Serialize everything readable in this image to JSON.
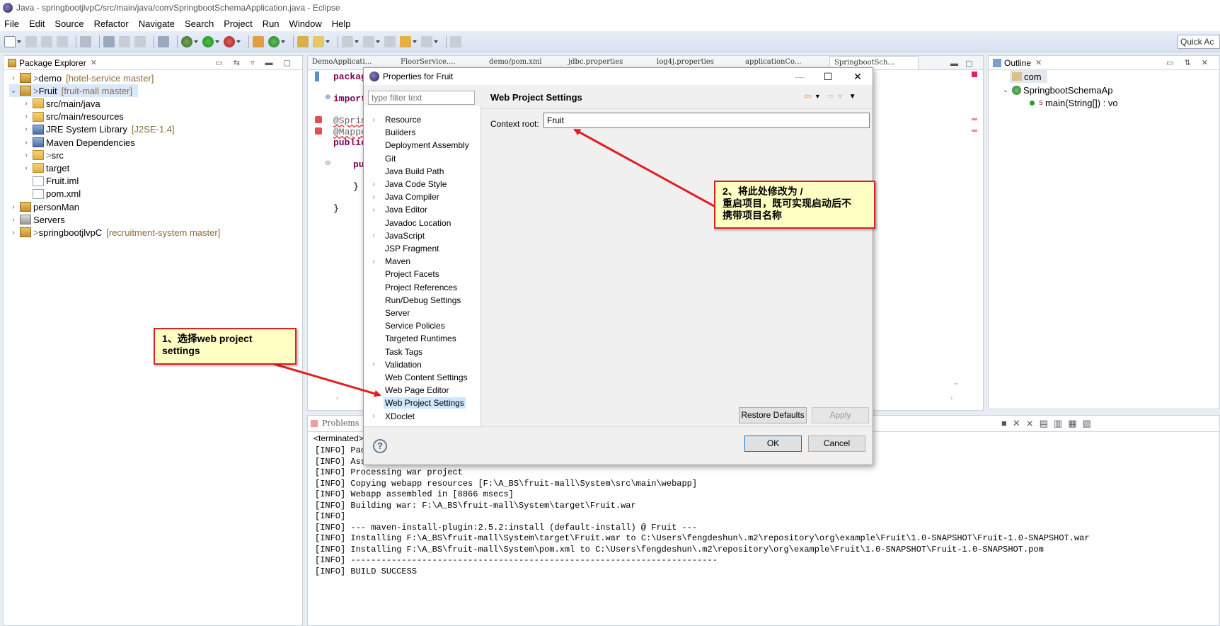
{
  "window": {
    "title": "Java - springbootjlvpC/src/main/java/com/SpringbootSchemaApplication.java - Eclipse"
  },
  "menu": [
    "File",
    "Edit",
    "Source",
    "Refactor",
    "Navigate",
    "Search",
    "Project",
    "Run",
    "Window",
    "Help"
  ],
  "quick_access": "Quick Ac",
  "package_explorer": {
    "title": "Package Explorer",
    "items": [
      {
        "arrow": "›",
        "prefix": "> ",
        "label": "demo",
        "deco": "[hotel-service master]",
        "indent": 0,
        "icon": "project-icon"
      },
      {
        "arrow": "⌄",
        "prefix": "> ",
        "label": "Fruit",
        "deco": "[fruit-mall master]",
        "indent": 0,
        "icon": "project-icon"
      },
      {
        "arrow": "›",
        "prefix": "",
        "label": "src/main/java",
        "deco": "",
        "indent": 1,
        "icon": "source-folder-icon"
      },
      {
        "arrow": "›",
        "prefix": "",
        "label": "src/main/resources",
        "deco": "",
        "indent": 1,
        "icon": "source-folder-icon"
      },
      {
        "arrow": "›",
        "prefix": "",
        "label": "JRE System Library",
        "deco": "[J2SE-1.4]",
        "indent": 1,
        "icon": "library-icon"
      },
      {
        "arrow": "›",
        "prefix": "",
        "label": "Maven Dependencies",
        "deco": "",
        "indent": 1,
        "icon": "library-icon"
      },
      {
        "arrow": "›",
        "prefix": "> ",
        "label": "src",
        "deco": "",
        "indent": 1,
        "icon": "folder-icon"
      },
      {
        "arrow": "›",
        "prefix": "",
        "label": "target",
        "deco": "",
        "indent": 1,
        "icon": "folder-icon"
      },
      {
        "arrow": "",
        "prefix": "",
        "label": "Fruit.iml",
        "deco": "",
        "indent": 1,
        "icon": "file-icon"
      },
      {
        "arrow": "",
        "prefix": "",
        "label": "pom.xml",
        "deco": "",
        "indent": 1,
        "icon": "file-icon"
      },
      {
        "arrow": "›",
        "prefix": "",
        "label": "personMan",
        "deco": "",
        "indent": 0,
        "icon": "project-icon"
      },
      {
        "arrow": "›",
        "prefix": "",
        "label": "Servers",
        "deco": "",
        "indent": 0,
        "icon": "server-icon"
      },
      {
        "arrow": "›",
        "prefix": "> ",
        "label": "springbootjlvpC",
        "deco": "[recruitment-system master]",
        "indent": 0,
        "icon": "project-icon"
      }
    ]
  },
  "editor_tabs": [
    "DemoApplicati...",
    "FloorService....",
    "demo/pom.xml",
    "jdbc.properties",
    "log4j.properties",
    "applicationCo...",
    "SpringbootSch..."
  ],
  "editor_code": {
    "l1": "packag",
    "l2": "import",
    "l3": "@Sprin",
    "l4": "@Mappe",
    "l5": "public",
    "l6": "pu",
    "l7": "}",
    "l8": "}"
  },
  "outline": {
    "title": "Outline",
    "items": [
      "com",
      "SpringbootSchemaAp",
      "main(String[]) : vo"
    ],
    "static_marker": "S"
  },
  "console": {
    "tab": "Problems",
    "terminated": "<terminated>",
    "lines": [
      "[INFO] Pac",
      "[INFO] Ass",
      "[INFO] Processing war project",
      "[INFO] Copying webapp resources [F:\\A_BS\\fruit-mall\\System\\src\\main\\webapp]",
      "[INFO] Webapp assembled in [8866 msecs]",
      "[INFO] Building war: F:\\A_BS\\fruit-mall\\System\\target\\Fruit.war",
      "[INFO]",
      "[INFO] --- maven-install-plugin:2.5.2:install (default-install) @ Fruit ---",
      "[INFO] Installing F:\\A_BS\\fruit-mall\\System\\target\\Fruit.war to C:\\Users\\fengdeshun\\.m2\\repository\\org\\example\\Fruit\\1.0-SNAPSHOT\\Fruit-1.0-SNAPSHOT.war",
      "[INFO] Installing F:\\A_BS\\fruit-mall\\System\\pom.xml to C:\\Users\\fengdeshun\\.m2\\repository\\org\\example\\Fruit\\1.0-SNAPSHOT\\Fruit-1.0-SNAPSHOT.pom",
      "[INFO] ------------------------------------------------------------------------",
      "[INFO] BUILD SUCCESS"
    ]
  },
  "dialog": {
    "title": "Properties for Fruit",
    "filter_placeholder": "type filter text",
    "nav": [
      {
        "label": "Resource",
        "expandable": "›"
      },
      {
        "label": "Builders",
        "expandable": ""
      },
      {
        "label": "Deployment Assembly",
        "expandable": ""
      },
      {
        "label": "Git",
        "expandable": ""
      },
      {
        "label": "Java Build Path",
        "expandable": ""
      },
      {
        "label": "Java Code Style",
        "expandable": "›"
      },
      {
        "label": "Java Compiler",
        "expandable": "›"
      },
      {
        "label": "Java Editor",
        "expandable": "›"
      },
      {
        "label": "Javadoc Location",
        "expandable": ""
      },
      {
        "label": "JavaScript",
        "expandable": "›"
      },
      {
        "label": "JSP Fragment",
        "expandable": ""
      },
      {
        "label": "Maven",
        "expandable": "›"
      },
      {
        "label": "Project Facets",
        "expandable": ""
      },
      {
        "label": "Project References",
        "expandable": ""
      },
      {
        "label": "Run/Debug Settings",
        "expandable": ""
      },
      {
        "label": "Server",
        "expandable": ""
      },
      {
        "label": "Service Policies",
        "expandable": ""
      },
      {
        "label": "Targeted Runtimes",
        "expandable": ""
      },
      {
        "label": "Task Tags",
        "expandable": ""
      },
      {
        "label": "Validation",
        "expandable": "›"
      },
      {
        "label": "Web Content Settings",
        "expandable": ""
      },
      {
        "label": "Web Page Editor",
        "expandable": ""
      },
      {
        "label": "Web Project Settings",
        "expandable": "",
        "selected": true
      },
      {
        "label": "XDoclet",
        "expandable": "›"
      }
    ],
    "page_title": "Web Project Settings",
    "context_root_label": "Context root:",
    "context_root_value": "Fruit",
    "restore_defaults": "Restore Defaults",
    "apply": "Apply",
    "ok": "OK",
    "cancel": "Cancel",
    "help_glyph": "?"
  },
  "callouts": {
    "step1": "1、选择web project settings",
    "step2_line1": "2、将此处修改为 /",
    "step2_line2": "重启项目，既可实现启动后不",
    "step2_line3": "携带项目名称"
  },
  "colors": {
    "callout_border": "#e02020",
    "callout_bg": "#ffffc4",
    "selection": "#cce8ff"
  }
}
